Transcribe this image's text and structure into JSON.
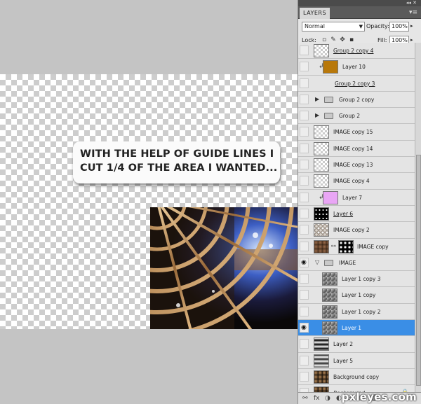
{
  "canvas": {
    "callout_line1": "WITH THE HELP OF GUIDE LINES I",
    "callout_line2": "CUT 1/4 OF THE AREA I WANTED..."
  },
  "panel": {
    "topstrip_controls": "◂◂  ✕",
    "tab": "LAYERS",
    "tab_menu": "▾≡",
    "blend_mode": "Normal",
    "opacity_label": "Opacity:",
    "opacity_value": "100%",
    "lock_label": "Lock:",
    "fill_label": "Fill:",
    "fill_value": "100%"
  },
  "layers": [
    {
      "name": "Group 2 copy 4",
      "thumb": "checker",
      "underline": true
    },
    {
      "name": "Layer 10",
      "thumb": "solid",
      "color": "#b8780a",
      "clip": true
    },
    {
      "name": "Group 2 copy 3",
      "thumb": "none",
      "underline": true
    },
    {
      "name": "Group 2 copy",
      "thumb": "folder",
      "triangle": "▶"
    },
    {
      "name": "Group 2",
      "thumb": "folder",
      "triangle": "▶"
    },
    {
      "name": "IMAGE copy 15",
      "thumb": "checker"
    },
    {
      "name": "IMAGE copy 14",
      "thumb": "checker"
    },
    {
      "name": "IMAGE copy 13",
      "thumb": "checker"
    },
    {
      "name": "IMAGE copy 4",
      "thumb": "checker"
    },
    {
      "name": "Layer 7",
      "thumb": "solid",
      "color": "#e9a6f5",
      "clip": true
    },
    {
      "name": "Layer 6",
      "thumb": "stars",
      "underline": true
    },
    {
      "name": "IMAGE copy 2",
      "thumb": "sketch"
    },
    {
      "name": "IMAGE copy",
      "thumb": "brown",
      "mask": true
    },
    {
      "name": "IMAGE",
      "thumb": "folder",
      "triangle": "▽",
      "visible": true
    },
    {
      "name": "Layer 1 copy 3",
      "thumb": "img1",
      "indent": true
    },
    {
      "name": "Layer 1 copy",
      "thumb": "img1",
      "indent": true
    },
    {
      "name": "Layer 1 copy 2",
      "thumb": "img1",
      "indent": true
    },
    {
      "name": "Layer 1",
      "thumb": "img1",
      "indent": true,
      "visible": true,
      "selected": true
    },
    {
      "name": "Layer 2",
      "thumb": "blackwhite"
    },
    {
      "name": "Layer 5",
      "thumb": "whiteblack"
    },
    {
      "name": "Background copy",
      "thumb": "dark"
    },
    {
      "name": "Background",
      "thumb": "dark",
      "italic": true,
      "locked": true
    }
  ],
  "bottom_icons": [
    "link-icon",
    "fx-icon",
    "mask-icon",
    "adjustment-icon",
    "folder-icon",
    "new-layer-icon",
    "trash-icon"
  ],
  "bottom_glyphs": [
    "⚯",
    "fx",
    "◑",
    "◐",
    "▭",
    "▢",
    "🗑"
  ],
  "watermark": "pxleyes.com",
  "colors": {
    "selection": "#3a8ee6",
    "panel_bg": "#e6e6e6",
    "canvas_bg": "#c4c4c4"
  }
}
